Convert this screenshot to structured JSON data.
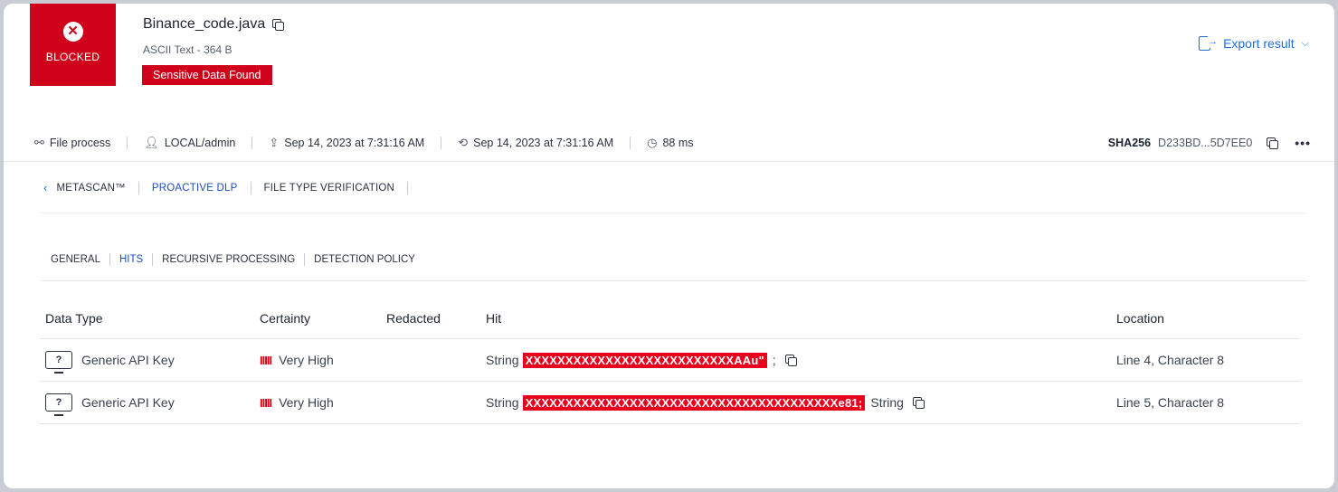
{
  "verdict": {
    "label": "BLOCKED",
    "icon": "close-circle-icon",
    "color": "#d0021b"
  },
  "file": {
    "name": "Binance_code.java",
    "meta": "ASCII Text - 364 B",
    "badge": "Sensitive Data Found"
  },
  "export": {
    "label": "Export result"
  },
  "info_bar": {
    "process": "File process",
    "user": "LOCAL/admin",
    "start_time": "Sep 14, 2023 at 7:31:16 AM",
    "end_time": "Sep 14, 2023 at 7:31:16 AM",
    "duration": "88 ms",
    "hash_label": "SHA256",
    "hash_value": "D233BD...5D7EE0",
    "more": "•••"
  },
  "nav_tabs": [
    {
      "label": "METASCAN™"
    },
    {
      "label": "PROACTIVE DLP"
    },
    {
      "label": "FILE TYPE VERIFICATION"
    }
  ],
  "sub_tabs": [
    {
      "label": "GENERAL"
    },
    {
      "label": "HITS"
    },
    {
      "label": "RECURSIVE PROCESSING"
    },
    {
      "label": "DETECTION POLICY"
    }
  ],
  "table": {
    "columns": [
      "Data Type",
      "Certainty",
      "Redacted",
      "Hit",
      "Location"
    ],
    "rows": [
      {
        "data_type": "Generic API Key",
        "certainty": "Very High",
        "certainty_bars": "IIIII",
        "redacted": "",
        "hit_prefix": "String",
        "hit_redacted": "XXXXXXXXXXXXXXXXXXXXXXXXXXAAu\"",
        "hit_suffix": ";",
        "location": "Line 4, Character 8"
      },
      {
        "data_type": "Generic API Key",
        "certainty": "Very High",
        "certainty_bars": "IIIII",
        "redacted": "",
        "hit_prefix": "String",
        "hit_redacted": "XXXXXXXXXXXXXXXXXXXXXXXXXXXXXXXXXXXXXXXe81;",
        "hit_suffix": "String",
        "location": "Line 5, Character 8"
      }
    ]
  }
}
